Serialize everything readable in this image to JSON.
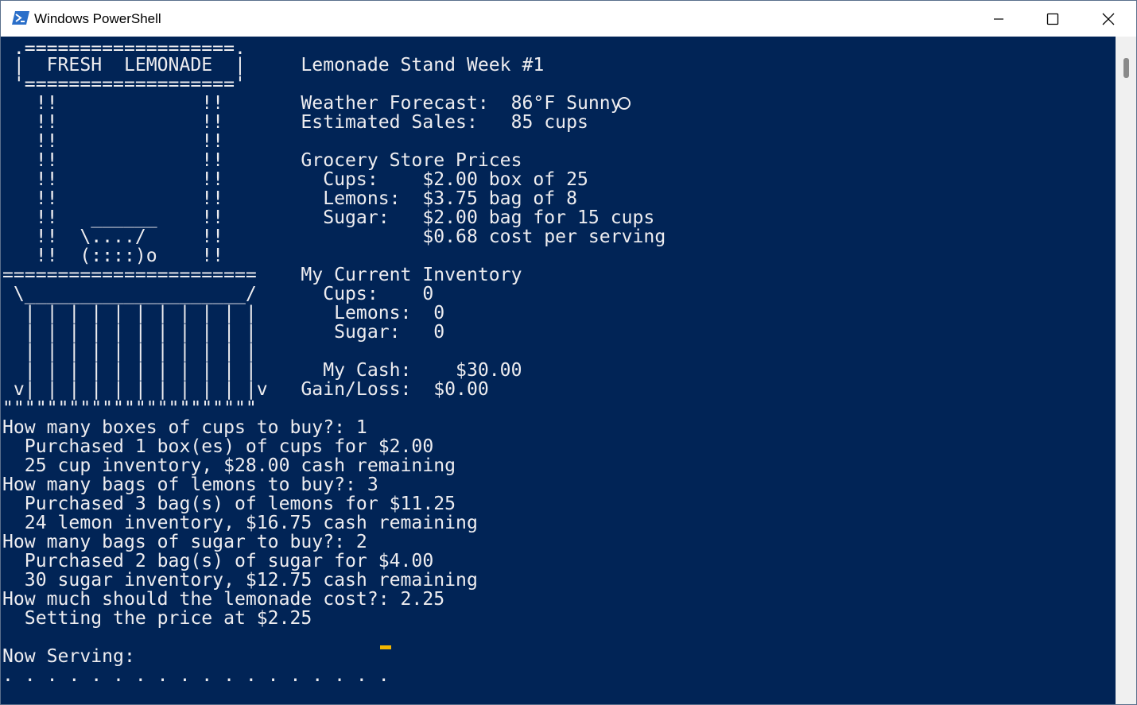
{
  "window": {
    "title": "Windows PowerShell",
    "icon": "powershell-icon",
    "controls": [
      "minimize-icon",
      "maximize-icon",
      "close-icon"
    ]
  },
  "colors": {
    "console_bg": "#012456",
    "console_fg": "#eeedf0",
    "cursor": "#f3b700"
  },
  "console": {
    "lines": [
      " .===================.",
      " |  FRESH  LEMONADE  |     Lemonade Stand Week #1",
      " '==================='",
      "   !!             !!       Weather Forecast:  86°F Sunny",
      "   !!             !!       Estimated Sales:   85 cups",
      "   !!             !!",
      "   !!             !!       Grocery Store Prices",
      "   !!             !!         Cups:    $2.00 box of 25",
      "   !!             !!         Lemons:  $3.75 bag of 8",
      "   !!   ______    !!         Sugar:   $2.00 bag for 15 cups",
      "   !!  \\..../     !!                  $0.68 cost per serving",
      "   !!  (::::)o    !!",
      "=======================    My Current Inventory",
      " \\____________________/      Cups:    0",
      "  | | | | | | | | | | |       Lemons:  0",
      "  | | | | | | | | | | |       Sugar:   0",
      "  | | | | | | | | | | |",
      "  | | | | | | | | | | |      My Cash:    $30.00",
      " v| | | | | | | | | | |v   Gain/Loss:  $0.00",
      "\"\"\"\"\"\"\"\"\"\"\"\"\"\"\"\"\"\"\"\"\"\"\"",
      "How many boxes of cups to buy?: 1",
      "  Purchased 1 box(es) of cups for $2.00",
      "  25 cup inventory, $28.00 cash remaining",
      "How many bags of lemons to buy?: 3",
      "  Purchased 3 bag(s) of lemons for $11.25",
      "  24 lemon inventory, $16.75 cash remaining",
      "How many bags of sugar to buy?: 2",
      "  Purchased 2 bag(s) of sugar for $4.00",
      "  30 sugar inventory, $12.75 cash remaining",
      "How much should the lemonade cost?: 2.25",
      "  Setting the price at $2.25",
      "",
      "Now Serving:",
      ". . . . . . . . . . . . . . . . . ."
    ]
  }
}
